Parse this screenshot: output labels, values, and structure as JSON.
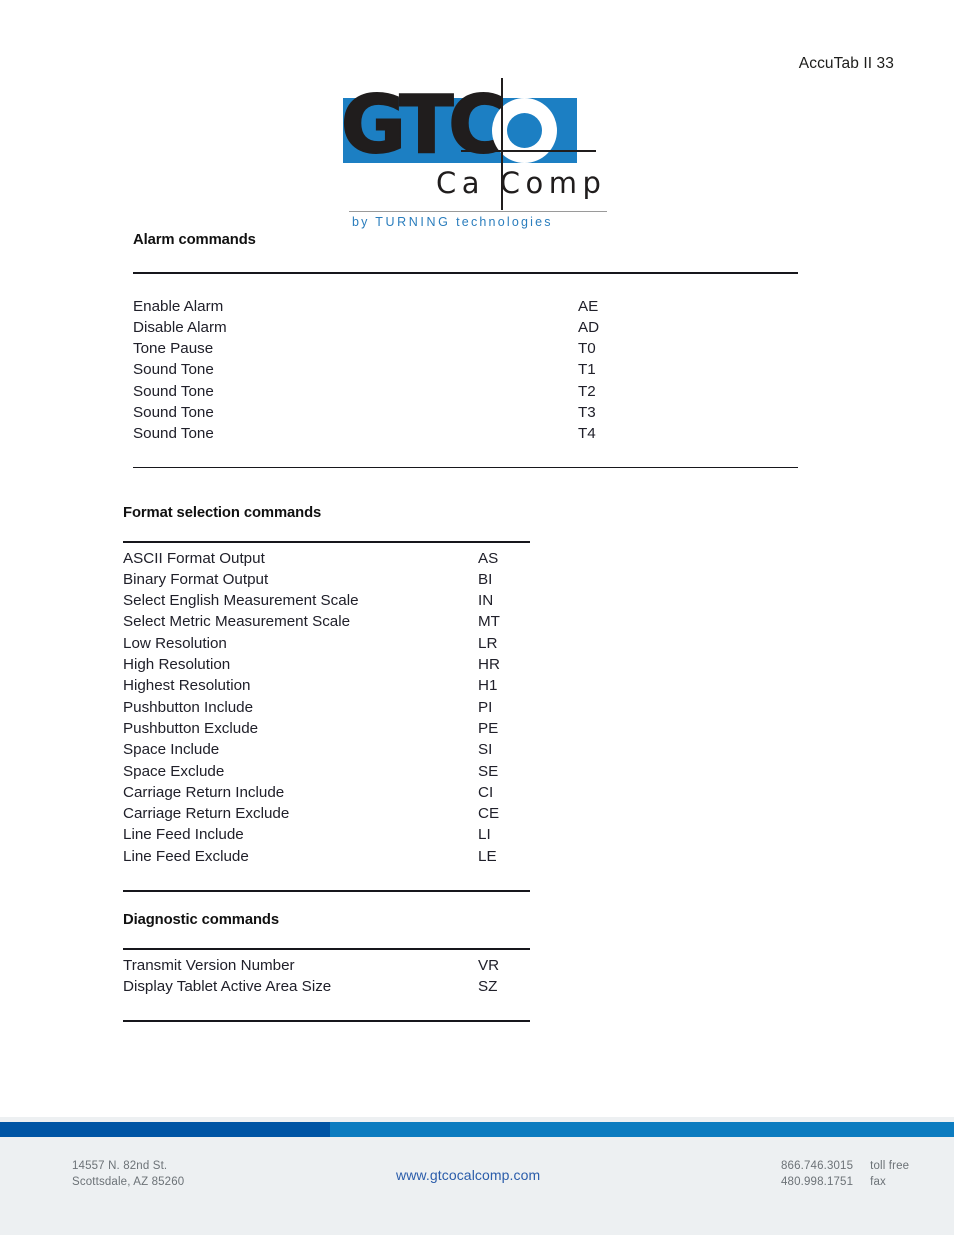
{
  "page": {
    "header_text": "AccuTab II 33"
  },
  "logo": {
    "wordmark": "GTC",
    "brand_second_line": "Ca Comp",
    "tagline_prefix": "by",
    "tagline_caps": "TURNING",
    "tagline_suffix": "technologies",
    "box_color": "#1c7fc3",
    "tagline_color": "#2a7dbd"
  },
  "sections": [
    {
      "id": "alarm",
      "title": "Alarm commands",
      "rows": [
        {
          "name": "Enable Alarm",
          "code": "AE"
        },
        {
          "name": "Disable Alarm",
          "code": "AD"
        },
        {
          "name": "Tone Pause",
          "code": "T0"
        },
        {
          "name": "Sound Tone",
          "code": "T1"
        },
        {
          "name": "Sound Tone",
          "code": "T2"
        },
        {
          "name": "Sound Tone",
          "code": "T3"
        },
        {
          "name": "Sound Tone",
          "code": "T4"
        }
      ]
    },
    {
      "id": "format",
      "title": "Format selection commands",
      "rows": [
        {
          "name": "ASCII Format Output",
          "code": "AS"
        },
        {
          "name": "Binary Format Output",
          "code": "BI"
        },
        {
          "name": "Select English Measurement Scale",
          "code": "IN"
        },
        {
          "name": "Select Metric Measurement Scale",
          "code": "MT"
        },
        {
          "name": "Low Resolution",
          "code": "LR"
        },
        {
          "name": "High Resolution",
          "code": "HR"
        },
        {
          "name": "Highest Resolution",
          "code": "H1"
        },
        {
          "name": "Pushbutton Include",
          "code": "PI"
        },
        {
          "name": "Pushbutton Exclude",
          "code": "PE"
        },
        {
          "name": "Space Include",
          "code": "SI"
        },
        {
          "name": "Space Exclude",
          "code": "SE"
        },
        {
          "name": "Carriage Return Include",
          "code": "CI"
        },
        {
          "name": "Carriage Return Exclude",
          "code": "CE"
        },
        {
          "name": "Line Feed Include",
          "code": "LI"
        },
        {
          "name": "Line Feed Exclude",
          "code": "LE"
        }
      ]
    },
    {
      "id": "diagnostic",
      "title": "Diagnostic commands",
      "rows": [
        {
          "name": "Transmit Version Number",
          "code": "VR"
        },
        {
          "name": "Display Tablet Active Area Size",
          "code": "SZ"
        }
      ]
    }
  ],
  "footer": {
    "address_line1": "14557 N. 82nd St.",
    "address_line2": "Scottsdale, AZ 85260",
    "website": "www.gtcocalcomp.com",
    "contacts": [
      {
        "number": "866.746.3015",
        "label": "toll free"
      },
      {
        "number": "480.998.1751",
        "label": "fax"
      }
    ],
    "bar_left_color": "#0055a5",
    "bar_right_color": "#0c7cc0"
  }
}
